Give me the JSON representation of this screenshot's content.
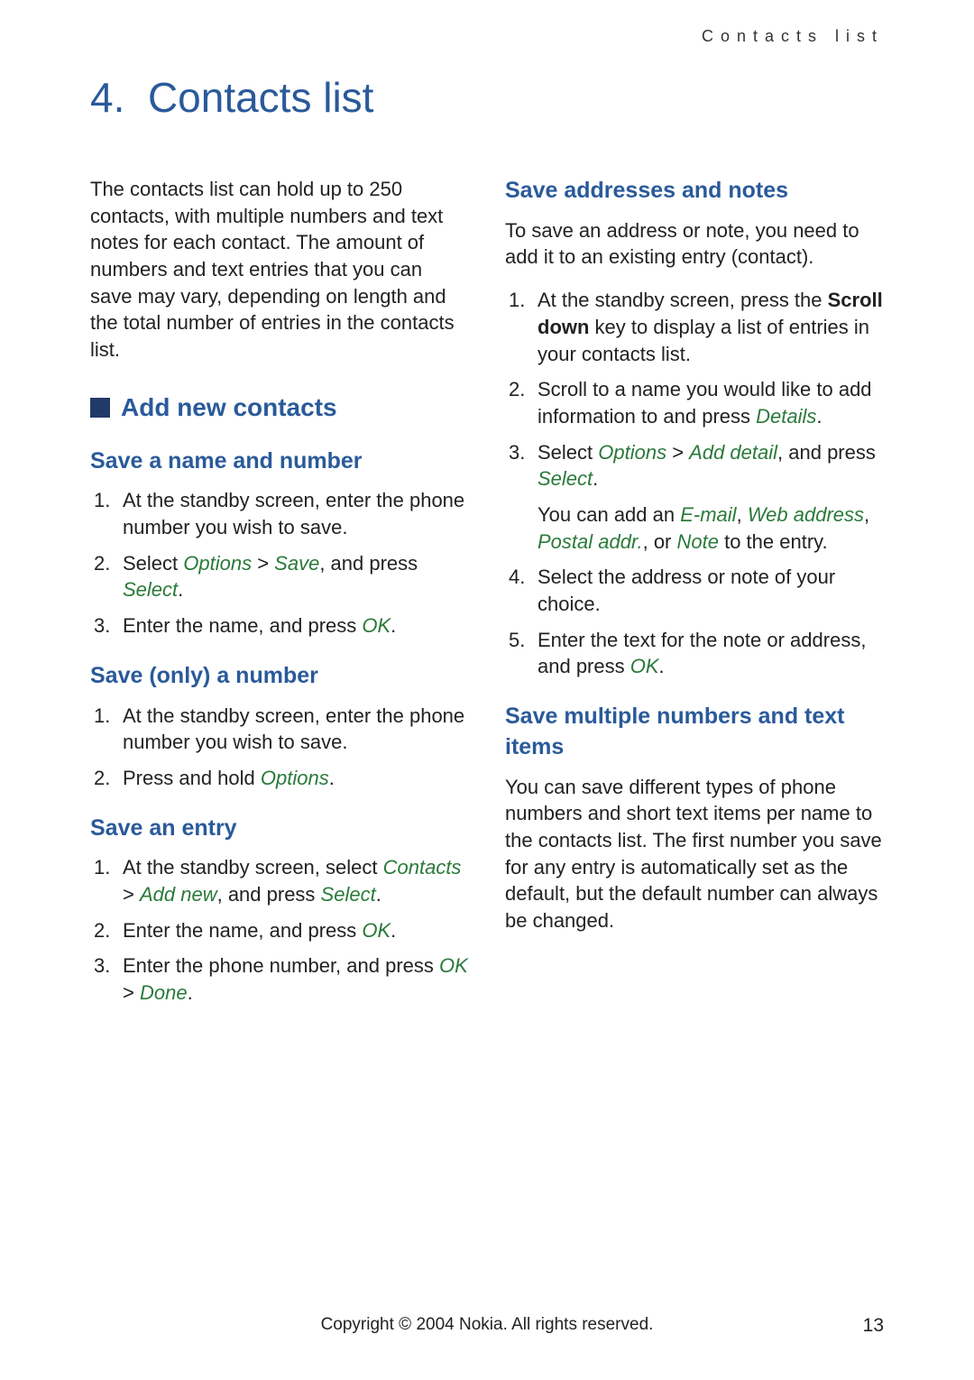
{
  "header": "Contacts list",
  "chapter_number": "4.",
  "chapter_title": "Contacts list",
  "intro": "The contacts list can hold up to 250 contacts, with multiple numbers and text notes for each contact. The amount of numbers and text entries that you can save may vary, depending on length and the total number of entries in the contacts list.",
  "section1": {
    "title": "Add new contacts",
    "sub1": {
      "title": "Save a name and number",
      "steps": {
        "s1a": "At the standby screen, enter the phone number you wish to save.",
        "s2a": "Select ",
        "s2b": "Options",
        "s2c": " > ",
        "s2d": "Save",
        "s2e": ", and press ",
        "s2f": "Select",
        "s2g": ".",
        "s3a": "Enter the name, and press ",
        "s3b": "OK",
        "s3c": "."
      }
    },
    "sub2": {
      "title": "Save (only) a number",
      "steps": {
        "s1a": "At the standby screen, enter the phone number you wish to save.",
        "s2a": "Press and hold ",
        "s2b": "Options",
        "s2c": "."
      }
    },
    "sub3": {
      "title": "Save an entry",
      "steps": {
        "s1a": "At the standby screen, select ",
        "s1b": "Contacts",
        "s1c": " > ",
        "s1d": "Add new",
        "s1e": ", and press ",
        "s1f": "Select",
        "s1g": ".",
        "s2a": "Enter the name, and press ",
        "s2b": "OK",
        "s2c": ".",
        "s3a": "Enter the phone number, and press ",
        "s3b": "OK",
        "s3c": " > ",
        "s3d": "Done",
        "s3e": "."
      }
    },
    "sub4": {
      "title": "Save addresses and notes",
      "intro": "To save an address or note, you need to add it to an existing entry (contact).",
      "steps": {
        "s1a": "At the standby screen, press the ",
        "s1b": "Scroll down",
        "s1c": " key to display a list of entries in your contacts list.",
        "s2a": "Scroll to a name you would like to add information to and press ",
        "s2b": "Details",
        "s2c": ".",
        "s3a": "Select ",
        "s3b": "Options",
        "s3c": " > ",
        "s3d": "Add detail",
        "s3e": ", and press ",
        "s3f": "Select",
        "s3g": ".",
        "s3h": "You can add an ",
        "s3i": "E-mail",
        "s3j": ", ",
        "s3k": "Web address",
        "s3l": ", ",
        "s3m": "Postal addr.",
        "s3n": ", or ",
        "s3o": "Note",
        "s3p": " to the entry.",
        "s4a": "Select the address or note of your choice.",
        "s5a": "Enter the text for the note or address, and press ",
        "s5b": "OK",
        "s5c": "."
      }
    },
    "sub5": {
      "title": "Save multiple numbers and text items",
      "body": "You can save different types of phone numbers and short text items per name to the contacts list. The first number you save for any entry is automatically set as the default, but the default number can always be changed."
    }
  },
  "footer": "Copyright © 2004 Nokia. All rights reserved.",
  "page": "13"
}
